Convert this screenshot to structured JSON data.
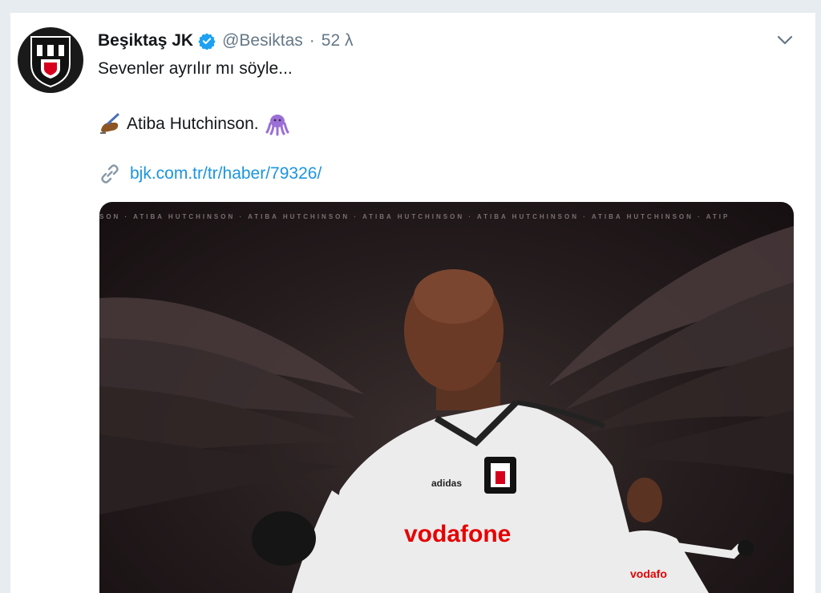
{
  "tweet": {
    "author_name": "Beşiktaş JK",
    "handle": "@Besiktas",
    "separator": "·",
    "time": "52 λ",
    "text_line1": "Sevenler ayrılır mı söyle...",
    "text_line2": "Atiba Hutchinson.",
    "link_text": "bjk.com.tr/tr/haber/79326/",
    "link_icon": "link-icon",
    "emoji_left": "writing-hand-emoji",
    "emoji_right": "octopus-emoji"
  },
  "media": {
    "ticker_text": "SON · ATIBA HUTCHINSON · ATIBA HUTCHINSON · ATIBA HUTCHINSON · ATIBA HUTCHINSON · ATIBA HUTCHINSON · ATIP",
    "jersey_sponsor": "vodafone",
    "jersey_brand": "adidas",
    "jersey_sponsor_small": "vodafo"
  },
  "colors": {
    "verified": "#1da1f2",
    "link": "#1b95e0",
    "text": "#14171a",
    "muted": "#657786",
    "sponsor_red": "#e60000"
  }
}
